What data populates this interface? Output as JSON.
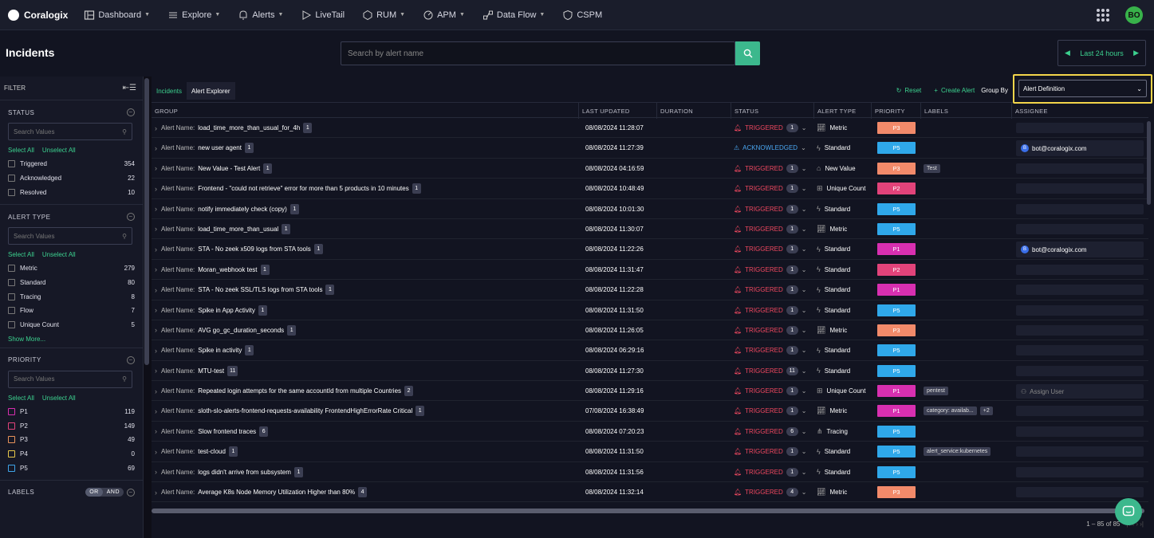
{
  "nav": {
    "brand": "Coralogix",
    "items": [
      {
        "label": "Dashboard",
        "icon": "dashboard-icon",
        "caret": true
      },
      {
        "label": "Explore",
        "icon": "explore-icon",
        "caret": true
      },
      {
        "label": "Alerts",
        "icon": "bell-icon",
        "caret": true
      },
      {
        "label": "LiveTail",
        "icon": "play-icon",
        "caret": false
      },
      {
        "label": "RUM",
        "icon": "rum-icon",
        "caret": true
      },
      {
        "label": "APM",
        "icon": "gauge-icon",
        "caret": true
      },
      {
        "label": "Data Flow",
        "icon": "dataflow-icon",
        "caret": true
      },
      {
        "label": "CSPM",
        "icon": "shield-icon",
        "caret": false
      }
    ],
    "avatar": "BO"
  },
  "header": {
    "title": "Incidents",
    "search_placeholder": "Search by alert name",
    "time_range": "Last 24 hours"
  },
  "filter": {
    "title": "FILTER",
    "select_all": "Select All",
    "unselect_all": "Unselect All",
    "search_placeholder": "Search Values",
    "status": {
      "title": "STATUS",
      "items": [
        {
          "label": "Triggered",
          "count": "354"
        },
        {
          "label": "Acknowledged",
          "count": "22"
        },
        {
          "label": "Resolved",
          "count": "10"
        }
      ]
    },
    "alert_type": {
      "title": "ALERT TYPE",
      "items": [
        {
          "label": "Metric",
          "count": "279"
        },
        {
          "label": "Standard",
          "count": "80"
        },
        {
          "label": "Tracing",
          "count": "8"
        },
        {
          "label": "Flow",
          "count": "7"
        },
        {
          "label": "Unique Count",
          "count": "5"
        }
      ],
      "show_more": "Show More..."
    },
    "priority": {
      "title": "PRIORITY",
      "items": [
        {
          "label": "P1",
          "count": "119",
          "color": "#d82fb0"
        },
        {
          "label": "P2",
          "count": "149",
          "color": "#e2437a"
        },
        {
          "label": "P3",
          "count": "49",
          "color": "#e8935a"
        },
        {
          "label": "P4",
          "count": "0",
          "color": "#e8c84a"
        },
        {
          "label": "P5",
          "count": "69",
          "color": "#3fa4e8"
        }
      ]
    },
    "labels": {
      "title": "LABELS",
      "or": "OR",
      "and": "AND"
    }
  },
  "main": {
    "tabs": {
      "incidents": "Incidents",
      "alert_explorer": "Alert Explorer"
    },
    "reset": "Reset",
    "create_alert": "Create Alert",
    "group_by_label": "Group By",
    "group_by_value": "Alert Definition",
    "columns": {
      "group": "GROUP",
      "last_updated": "LAST UPDATED",
      "duration": "DURATION",
      "status": "STATUS",
      "alert_type": "ALERT TYPE",
      "priority": "PRIORITY",
      "labels": "LABELS",
      "assignee": "ASSIGNEE"
    },
    "group_prefix": "Alert Name:",
    "rows": [
      {
        "name": "load_time_more_than_usual_for_4h",
        "count": "1",
        "updated": "08/08/2024 11:28:07",
        "status": "TRIGGERED",
        "status_count": "1",
        "type": "Metric",
        "type_icon": "metric-icon",
        "priority": "P3",
        "labels": [],
        "assignee": ""
      },
      {
        "name": "new user agent",
        "count": "1",
        "updated": "08/08/2024 11:27:39",
        "status": "ACKNOWLEDGED",
        "status_count": "",
        "type": "Standard",
        "type_icon": "standard-icon",
        "priority": "P5",
        "labels": [],
        "assignee": "bot@coralogix.com"
      },
      {
        "name": "New Value - Test Alert",
        "count": "1",
        "updated": "08/08/2024 04:16:59",
        "status": "TRIGGERED",
        "status_count": "1",
        "type": "New Value",
        "type_icon": "newvalue-icon",
        "priority": "P3",
        "labels": [
          "Test"
        ],
        "assignee": ""
      },
      {
        "name": "Frontend - \"could not retrieve\" error for more than 5 products in 10 minutes",
        "count": "1",
        "updated": "08/08/2024 10:48:49",
        "status": "TRIGGERED",
        "status_count": "1",
        "type": "Unique Count",
        "type_icon": "uniquecount-icon",
        "priority": "P2",
        "labels": [],
        "assignee": ""
      },
      {
        "name": "notify immediately check (copy)",
        "count": "1",
        "updated": "08/08/2024 10:01:30",
        "status": "TRIGGERED",
        "status_count": "1",
        "type": "Standard",
        "type_icon": "standard-icon",
        "priority": "P5",
        "labels": [],
        "assignee": ""
      },
      {
        "name": "load_time_more_than_usual",
        "count": "1",
        "updated": "08/08/2024 11:30:07",
        "status": "TRIGGERED",
        "status_count": "1",
        "type": "Metric",
        "type_icon": "metric-icon",
        "priority": "P5",
        "labels": [],
        "assignee": ""
      },
      {
        "name": "STA - No zeek x509 logs from STA tools",
        "count": "1",
        "updated": "08/08/2024 11:22:26",
        "status": "TRIGGERED",
        "status_count": "1",
        "type": "Standard",
        "type_icon": "standard-icon",
        "priority": "P1",
        "labels": [],
        "assignee": "bot@coralogix.com"
      },
      {
        "name": "Moran_webhook test",
        "count": "1",
        "updated": "08/08/2024 11:31:47",
        "status": "TRIGGERED",
        "status_count": "1",
        "type": "Standard",
        "type_icon": "standard-icon",
        "priority": "P2",
        "labels": [],
        "assignee": ""
      },
      {
        "name": "STA - No zeek SSL/TLS logs from STA tools",
        "count": "1",
        "updated": "08/08/2024 11:22:28",
        "status": "TRIGGERED",
        "status_count": "1",
        "type": "Standard",
        "type_icon": "standard-icon",
        "priority": "P1",
        "labels": [],
        "assignee": ""
      },
      {
        "name": "Spike in App Activity",
        "count": "1",
        "updated": "08/08/2024 11:31:50",
        "status": "TRIGGERED",
        "status_count": "1",
        "type": "Standard",
        "type_icon": "standard-icon",
        "priority": "P5",
        "labels": [],
        "assignee": ""
      },
      {
        "name": "AVG go_gc_duration_seconds",
        "count": "1",
        "updated": "08/08/2024 11:26:05",
        "status": "TRIGGERED",
        "status_count": "1",
        "type": "Metric",
        "type_icon": "metric-icon",
        "priority": "P3",
        "labels": [],
        "assignee": ""
      },
      {
        "name": "Spike in activity",
        "count": "1",
        "updated": "08/08/2024 06:29:16",
        "status": "TRIGGERED",
        "status_count": "1",
        "type": "Standard",
        "type_icon": "standard-icon",
        "priority": "P5",
        "labels": [],
        "assignee": ""
      },
      {
        "name": "MTU-test",
        "count": "11",
        "updated": "08/08/2024 11:27:30",
        "status": "TRIGGERED",
        "status_count": "11",
        "type": "Standard",
        "type_icon": "standard-icon",
        "priority": "P5",
        "labels": [],
        "assignee": ""
      },
      {
        "name": "Repeated login attempts for the same accountId from multiple Countries",
        "count": "2",
        "updated": "08/08/2024 11:29:16",
        "status": "TRIGGERED",
        "status_count": "1",
        "type": "Unique Count",
        "type_icon": "uniquecount-icon",
        "priority": "P1",
        "labels": [
          "pentest"
        ],
        "assignee": "Assign User"
      },
      {
        "name": "sloth-slo-alerts-frontend-requests-availability FrontendHighErrorRate Critical",
        "count": "1",
        "updated": "07/08/2024 16:38:49",
        "status": "TRIGGERED",
        "status_count": "1",
        "type": "Metric",
        "type_icon": "metric-icon",
        "priority": "P1",
        "labels": [
          "category: availab...",
          "+2"
        ],
        "assignee": ""
      },
      {
        "name": "Slow frontend traces",
        "count": "6",
        "updated": "08/08/2024 07:20:23",
        "status": "TRIGGERED",
        "status_count": "6",
        "type": "Tracing",
        "type_icon": "tracing-icon",
        "priority": "P5",
        "labels": [],
        "assignee": ""
      },
      {
        "name": "test-cloud",
        "count": "1",
        "updated": "08/08/2024 11:31:50",
        "status": "TRIGGERED",
        "status_count": "1",
        "type": "Standard",
        "type_icon": "standard-icon",
        "priority": "P5",
        "labels": [
          "alert_service:kubernetes"
        ],
        "assignee": ""
      },
      {
        "name": "logs didn't arrive from subsystem",
        "count": "1",
        "updated": "08/08/2024 11:31:56",
        "status": "TRIGGERED",
        "status_count": "1",
        "type": "Standard",
        "type_icon": "standard-icon",
        "priority": "P5",
        "labels": [],
        "assignee": ""
      },
      {
        "name": "Average K8s Node Memory Utilization Higher than 80%",
        "count": "4",
        "updated": "08/08/2024 11:32:14",
        "status": "TRIGGERED",
        "status_count": "4",
        "type": "Metric",
        "type_icon": "metric-icon",
        "priority": "P3",
        "labels": [],
        "assignee": ""
      }
    ],
    "pagination": "1 – 85 of 85"
  },
  "colors": {
    "accent": "#3cd18f",
    "triggered": "#f04860",
    "acknowledged": "#4aa6f0",
    "P1": "#d82fb0",
    "P2": "#e2437a",
    "P3": "#f28a6a",
    "P5": "#2fa8ea",
    "highlight": "#f3d54a"
  }
}
